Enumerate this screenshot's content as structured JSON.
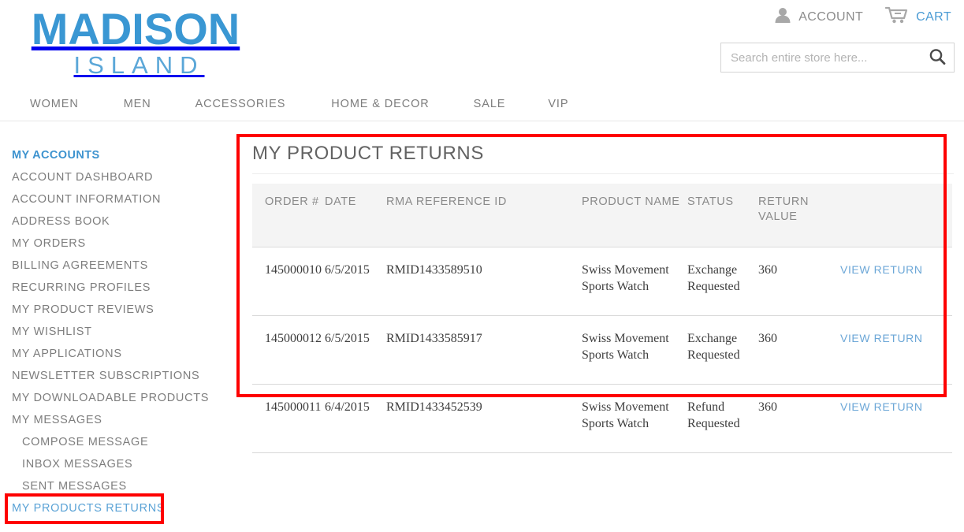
{
  "brand": {
    "name_top": "MADISON",
    "name_bottom": "ISLAND"
  },
  "header": {
    "account_label": "ACCOUNT",
    "cart_label": "CART",
    "account_icon": "person-icon",
    "cart_icon": "cart-icon",
    "search_icon": "search-icon",
    "search_placeholder": "Search entire store here...",
    "search_value": ""
  },
  "nav": {
    "items": [
      {
        "label": "WOMEN"
      },
      {
        "label": "MEN"
      },
      {
        "label": "ACCESSORIES"
      },
      {
        "label": "HOME & DECOR"
      },
      {
        "label": "SALE"
      },
      {
        "label": "VIP"
      }
    ]
  },
  "sidebar": {
    "heading": "MY ACCOUNTS",
    "items": [
      {
        "label": "ACCOUNT DASHBOARD"
      },
      {
        "label": "ACCOUNT INFORMATION"
      },
      {
        "label": "ADDRESS BOOK"
      },
      {
        "label": "MY ORDERS"
      },
      {
        "label": "BILLING AGREEMENTS"
      },
      {
        "label": "RECURRING PROFILES"
      },
      {
        "label": "MY PRODUCT REVIEWS"
      },
      {
        "label": "MY WISHLIST"
      },
      {
        "label": "MY APPLICATIONS"
      },
      {
        "label": "NEWSLETTER SUBSCRIPTIONS"
      },
      {
        "label": "MY DOWNLOADABLE PRODUCTS"
      },
      {
        "label": "MY MESSAGES"
      },
      {
        "label": "COMPOSE MESSAGE"
      },
      {
        "label": "INBOX MESSAGES"
      },
      {
        "label": "SENT MESSAGES"
      },
      {
        "label": "MY PRODUCTS RETURNS"
      }
    ]
  },
  "main": {
    "title": "MY PRODUCT RETURNS",
    "table": {
      "columns": [
        "ORDER #",
        "DATE",
        "RMA REFERENCE ID",
        "PRODUCT NAME",
        "STATUS",
        "RETURN VALUE",
        ""
      ],
      "rows": [
        {
          "order": "145000010",
          "date": "6/5/2015",
          "rma": "RMID1433589510",
          "product": "Swiss Movement Sports Watch",
          "status": "Exchange Requested",
          "value": "360",
          "action": "VIEW RETURN"
        },
        {
          "order": "145000012",
          "date": "6/5/2015",
          "rma": "RMID1433585917",
          "product": "Swiss Movement Sports Watch",
          "status": "Exchange Requested",
          "value": "360",
          "action": "VIEW RETURN"
        },
        {
          "order": "145000011",
          "date": "6/4/2015",
          "rma": "RMID1433452539",
          "product": "Swiss Movement Sports Watch",
          "status": "Refund Requested",
          "value": "360",
          "action": "VIEW RETURN"
        }
      ]
    }
  },
  "colors": {
    "brand_blue": "#3a97d3",
    "link_blue": "#6ca7d7",
    "highlight_red": "#fe0000",
    "text_gray": "#7d7d7d"
  }
}
